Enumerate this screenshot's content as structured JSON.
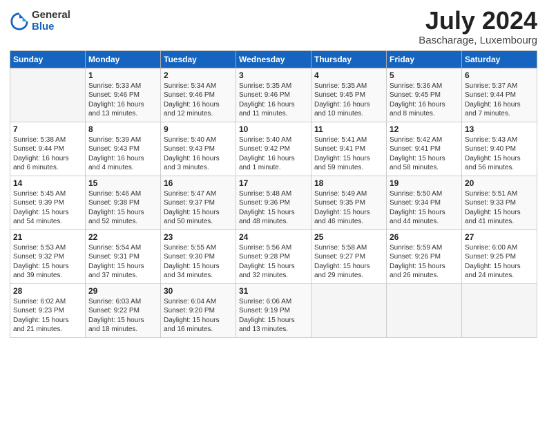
{
  "header": {
    "logo_general": "General",
    "logo_blue": "Blue",
    "month_title": "July 2024",
    "location": "Bascharage, Luxembourg"
  },
  "days_of_week": [
    "Sunday",
    "Monday",
    "Tuesday",
    "Wednesday",
    "Thursday",
    "Friday",
    "Saturday"
  ],
  "weeks": [
    [
      {
        "day": "",
        "content": ""
      },
      {
        "day": "1",
        "content": "Sunrise: 5:33 AM\nSunset: 9:46 PM\nDaylight: 16 hours\nand 13 minutes."
      },
      {
        "day": "2",
        "content": "Sunrise: 5:34 AM\nSunset: 9:46 PM\nDaylight: 16 hours\nand 12 minutes."
      },
      {
        "day": "3",
        "content": "Sunrise: 5:35 AM\nSunset: 9:46 PM\nDaylight: 16 hours\nand 11 minutes."
      },
      {
        "day": "4",
        "content": "Sunrise: 5:35 AM\nSunset: 9:45 PM\nDaylight: 16 hours\nand 10 minutes."
      },
      {
        "day": "5",
        "content": "Sunrise: 5:36 AM\nSunset: 9:45 PM\nDaylight: 16 hours\nand 8 minutes."
      },
      {
        "day": "6",
        "content": "Sunrise: 5:37 AM\nSunset: 9:44 PM\nDaylight: 16 hours\nand 7 minutes."
      }
    ],
    [
      {
        "day": "7",
        "content": "Sunrise: 5:38 AM\nSunset: 9:44 PM\nDaylight: 16 hours\nand 6 minutes."
      },
      {
        "day": "8",
        "content": "Sunrise: 5:39 AM\nSunset: 9:43 PM\nDaylight: 16 hours\nand 4 minutes."
      },
      {
        "day": "9",
        "content": "Sunrise: 5:40 AM\nSunset: 9:43 PM\nDaylight: 16 hours\nand 3 minutes."
      },
      {
        "day": "10",
        "content": "Sunrise: 5:40 AM\nSunset: 9:42 PM\nDaylight: 16 hours\nand 1 minute."
      },
      {
        "day": "11",
        "content": "Sunrise: 5:41 AM\nSunset: 9:41 PM\nDaylight: 15 hours\nand 59 minutes."
      },
      {
        "day": "12",
        "content": "Sunrise: 5:42 AM\nSunset: 9:41 PM\nDaylight: 15 hours\nand 58 minutes."
      },
      {
        "day": "13",
        "content": "Sunrise: 5:43 AM\nSunset: 9:40 PM\nDaylight: 15 hours\nand 56 minutes."
      }
    ],
    [
      {
        "day": "14",
        "content": "Sunrise: 5:45 AM\nSunset: 9:39 PM\nDaylight: 15 hours\nand 54 minutes."
      },
      {
        "day": "15",
        "content": "Sunrise: 5:46 AM\nSunset: 9:38 PM\nDaylight: 15 hours\nand 52 minutes."
      },
      {
        "day": "16",
        "content": "Sunrise: 5:47 AM\nSunset: 9:37 PM\nDaylight: 15 hours\nand 50 minutes."
      },
      {
        "day": "17",
        "content": "Sunrise: 5:48 AM\nSunset: 9:36 PM\nDaylight: 15 hours\nand 48 minutes."
      },
      {
        "day": "18",
        "content": "Sunrise: 5:49 AM\nSunset: 9:35 PM\nDaylight: 15 hours\nand 46 minutes."
      },
      {
        "day": "19",
        "content": "Sunrise: 5:50 AM\nSunset: 9:34 PM\nDaylight: 15 hours\nand 44 minutes."
      },
      {
        "day": "20",
        "content": "Sunrise: 5:51 AM\nSunset: 9:33 PM\nDaylight: 15 hours\nand 41 minutes."
      }
    ],
    [
      {
        "day": "21",
        "content": "Sunrise: 5:53 AM\nSunset: 9:32 PM\nDaylight: 15 hours\nand 39 minutes."
      },
      {
        "day": "22",
        "content": "Sunrise: 5:54 AM\nSunset: 9:31 PM\nDaylight: 15 hours\nand 37 minutes."
      },
      {
        "day": "23",
        "content": "Sunrise: 5:55 AM\nSunset: 9:30 PM\nDaylight: 15 hours\nand 34 minutes."
      },
      {
        "day": "24",
        "content": "Sunrise: 5:56 AM\nSunset: 9:28 PM\nDaylight: 15 hours\nand 32 minutes."
      },
      {
        "day": "25",
        "content": "Sunrise: 5:58 AM\nSunset: 9:27 PM\nDaylight: 15 hours\nand 29 minutes."
      },
      {
        "day": "26",
        "content": "Sunrise: 5:59 AM\nSunset: 9:26 PM\nDaylight: 15 hours\nand 26 minutes."
      },
      {
        "day": "27",
        "content": "Sunrise: 6:00 AM\nSunset: 9:25 PM\nDaylight: 15 hours\nand 24 minutes."
      }
    ],
    [
      {
        "day": "28",
        "content": "Sunrise: 6:02 AM\nSunset: 9:23 PM\nDaylight: 15 hours\nand 21 minutes."
      },
      {
        "day": "29",
        "content": "Sunrise: 6:03 AM\nSunset: 9:22 PM\nDaylight: 15 hours\nand 18 minutes."
      },
      {
        "day": "30",
        "content": "Sunrise: 6:04 AM\nSunset: 9:20 PM\nDaylight: 15 hours\nand 16 minutes."
      },
      {
        "day": "31",
        "content": "Sunrise: 6:06 AM\nSunset: 9:19 PM\nDaylight: 15 hours\nand 13 minutes."
      },
      {
        "day": "",
        "content": ""
      },
      {
        "day": "",
        "content": ""
      },
      {
        "day": "",
        "content": ""
      }
    ]
  ]
}
